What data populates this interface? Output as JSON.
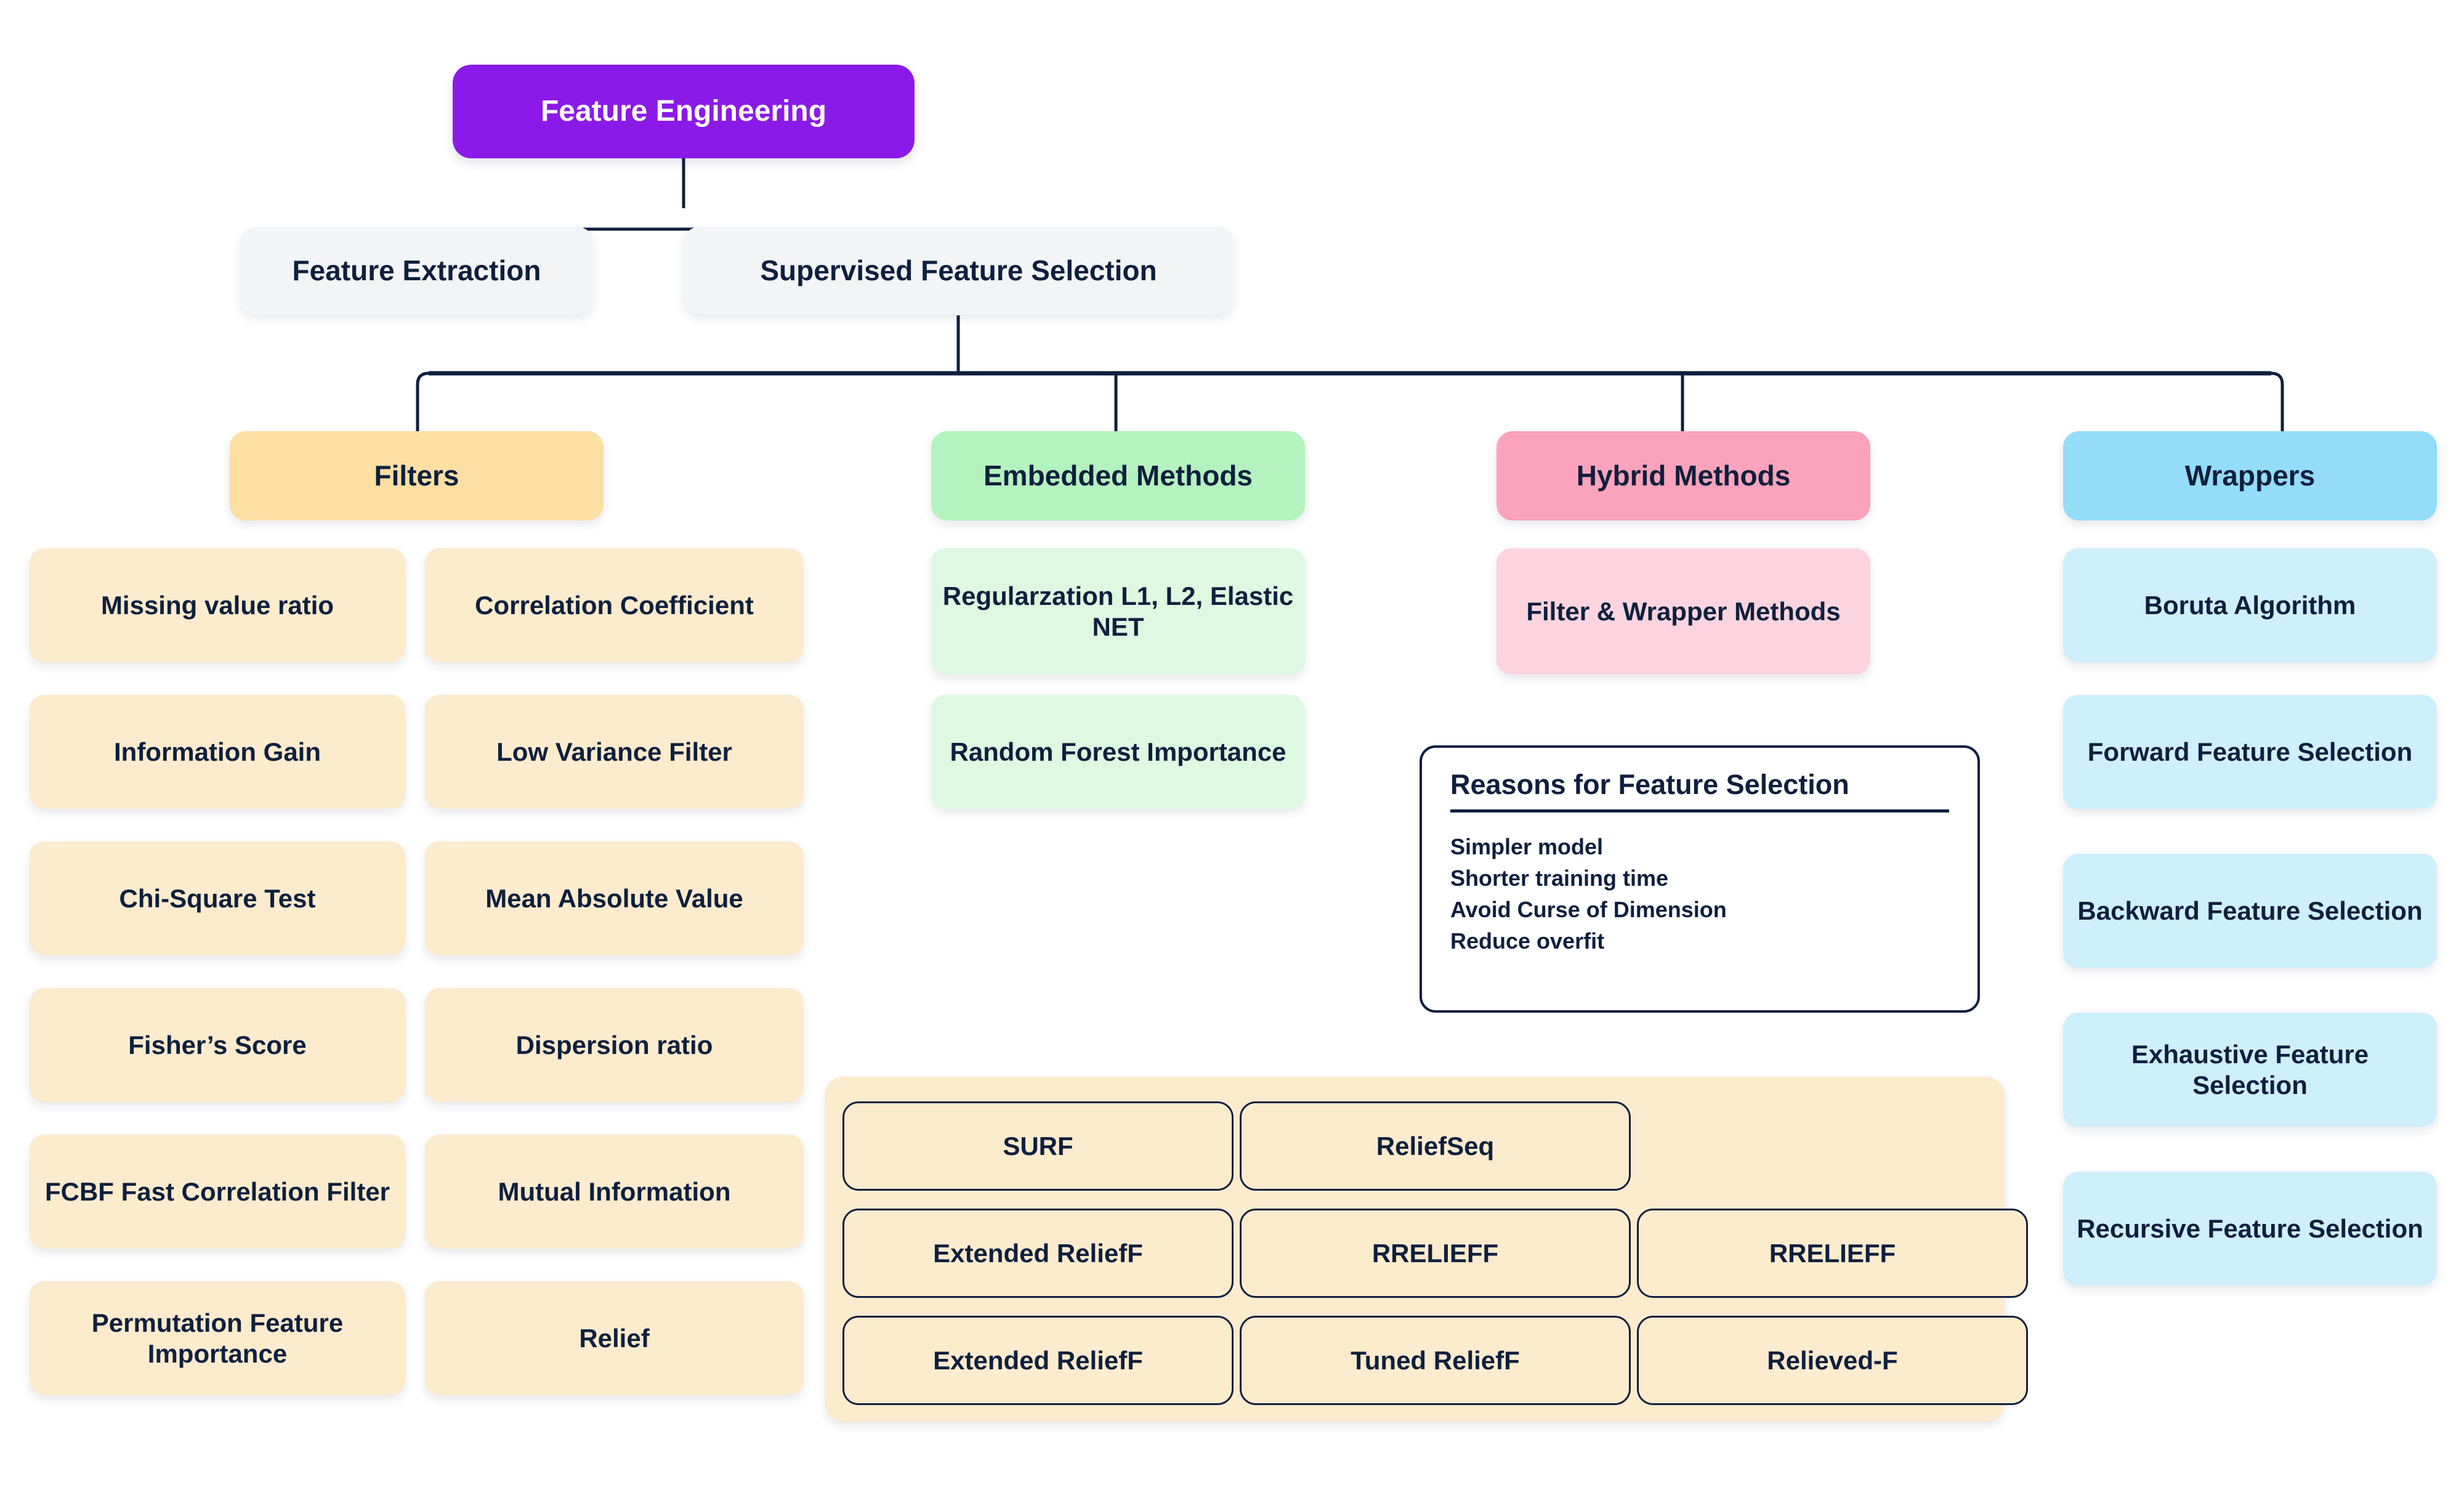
{
  "diagram": {
    "title": "Feature Engineering",
    "root": {
      "label": "Feature Engineering",
      "color": "#8B1AE8",
      "text_color": "#FFFFFF"
    },
    "level2": [
      {
        "label": "Feature Extraction",
        "color": "#F3F4F6"
      },
      {
        "label": "Supervised Feature Selection",
        "color": "#F3F4F6"
      }
    ],
    "categories": [
      {
        "label": "Filters",
        "header_color": "#FBDFA3",
        "item_color": "#FCEBCD",
        "items": [
          "Missing value ratio",
          "Correlation Coefficient",
          "Information Gain",
          "Low Variance Filter",
          "Chi-Square Test",
          "Mean Absolute Value",
          "Fisher’s Score",
          "Dispersion ratio",
          "FCBF Fast Correlation Filter",
          "Mutual Information",
          "Permutation Feature Importance",
          "Relief"
        ]
      },
      {
        "label": "Embedded Methods",
        "header_color": "#B4F2C0",
        "item_color": "#DEF9E2",
        "items": [
          "Regularzation L1, L2, Elastic NET",
          "Random Forest Importance"
        ]
      },
      {
        "label": "Hybrid Methods",
        "header_color": "#FBA3BC",
        "item_color": "#FBD4E0",
        "items": [
          "Filter & Wrapper Methods"
        ]
      },
      {
        "label": "Wrappers",
        "header_color": "#93DDF8",
        "item_color": "#CEEFFC",
        "items": [
          "Boruta Algorithm",
          "Forward Feature Selection",
          "Backward Feature Selection",
          "Exhaustive Feature Selection",
          "Recursive Feature Selection"
        ]
      }
    ],
    "relief_variants": {
      "panel_color": "#FCEBCD",
      "border_color": "#101F3F",
      "rows": [
        [
          "SURF",
          "ReliefSeq"
        ],
        [
          "Extended ReliefF",
          "RRELIEFF",
          "RRELIEFF"
        ],
        [
          "Extended ReliefF",
          "Tuned ReliefF",
          "Relieved-F"
        ]
      ]
    },
    "reasons": {
      "title": "Reasons for Feature Selection",
      "items": [
        "Simpler model",
        "Shorter training time",
        "Avoid Curse of Dimension",
        "Reduce overfit"
      ]
    },
    "connector_color": "#101F3F"
  }
}
